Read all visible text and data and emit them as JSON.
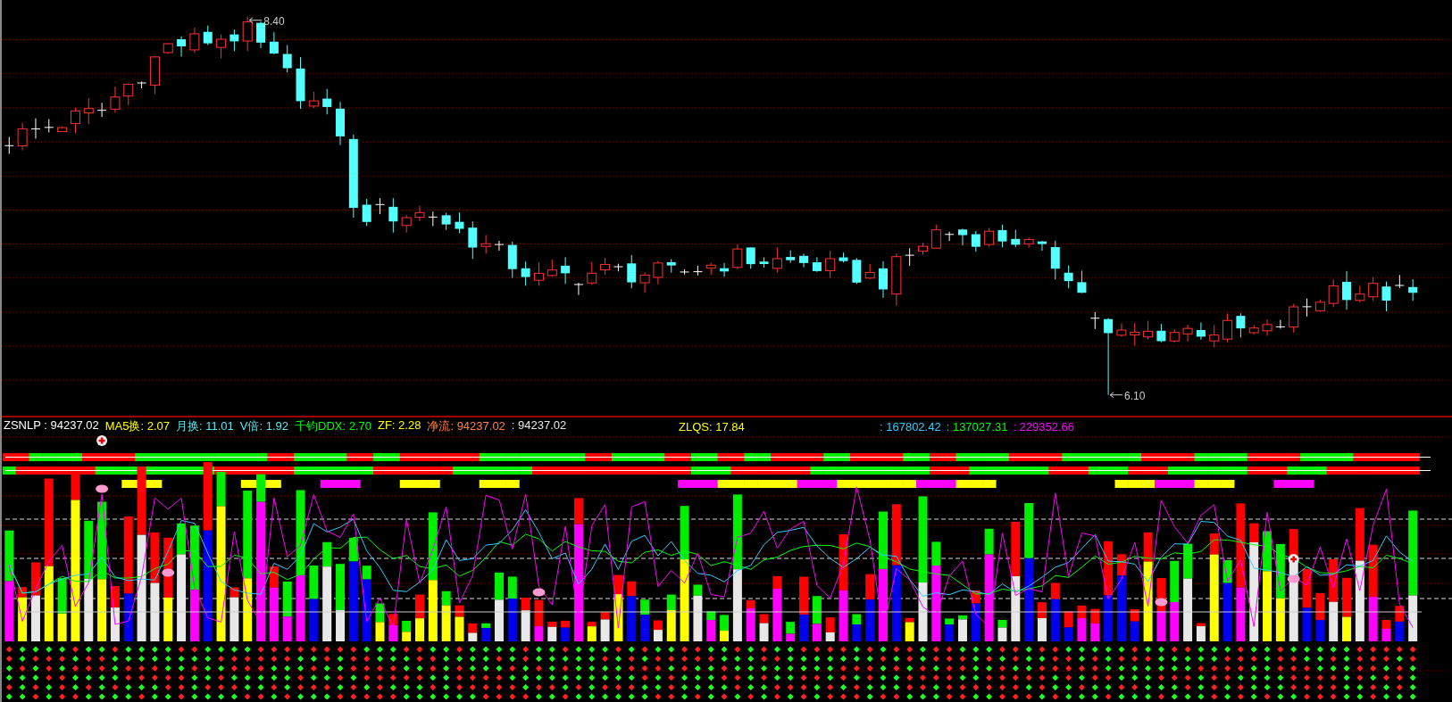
{
  "chart": {
    "high_label": "8.40",
    "low_label": "6.10"
  },
  "indicators": {
    "left": [
      {
        "text": "ZSNLP : 94237.02",
        "color": "#ffffff"
      },
      {
        "text": "MA5换: 2.07",
        "color": "#ffff00"
      },
      {
        "text": "月换: 11.01",
        "color": "#5fe8f0"
      },
      {
        "text": "V倍: 1.92",
        "color": "#5fe8f0"
      },
      {
        "text": "千钧DDX: 2.70",
        "color": "#00ff00"
      },
      {
        "text": "ZF: 2.28",
        "color": "#ffff00"
      },
      {
        "text": "净流: 94237.02",
        "color": "#ff8040"
      },
      {
        "text": ": 94237.02",
        "color": "#e8e8e8"
      }
    ],
    "middle": [
      {
        "text": "ZLQS: 17.84",
        "color": "#ffff00"
      }
    ],
    "right": [
      {
        "text": ": 167802.42",
        "color": "#33ccff"
      },
      {
        "text": ": 137027.31",
        "color": "#00ff00"
      },
      {
        "text": ": 229352.66",
        "color": "#ff00ff"
      }
    ]
  }
}
